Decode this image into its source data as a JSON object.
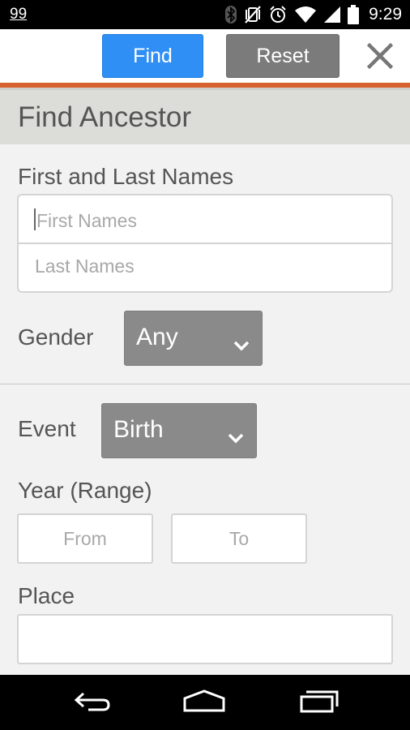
{
  "status_bar": {
    "notification_count": "99",
    "time": "9:29",
    "icons": [
      "bluetooth-icon",
      "vibrate-icon",
      "alarm-icon",
      "wifi-icon",
      "signal-icon",
      "battery-icon"
    ]
  },
  "toolbar": {
    "find_label": "Find",
    "reset_label": "Reset",
    "close_icon": "close-icon",
    "find_color": "#2f8ff5",
    "reset_color": "#7b7b7b",
    "accent_color": "#d8622f"
  },
  "page": {
    "title": "Find Ancestor"
  },
  "form": {
    "names_label": "First and Last Names",
    "first_names_placeholder": "First Names",
    "last_names_placeholder": "Last Names",
    "gender_label": "Gender",
    "gender_value": "Any",
    "event_label": "Event",
    "event_value": "Birth",
    "year_label": "Year (Range)",
    "year_from_placeholder": "From",
    "year_to_placeholder": "To",
    "place_label": "Place",
    "place_value": ""
  },
  "nav_bar": {
    "icons": [
      "back-icon",
      "home-icon",
      "recent-apps-icon"
    ]
  }
}
